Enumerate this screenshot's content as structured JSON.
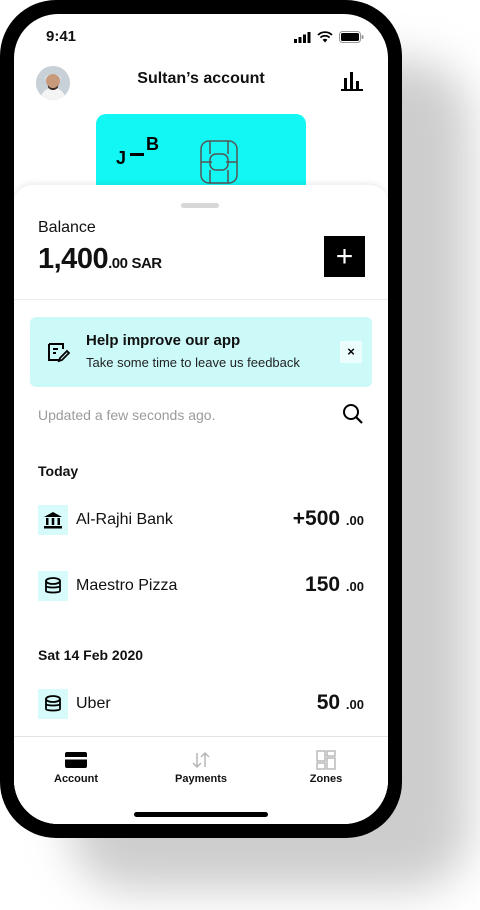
{
  "status_bar": {
    "time": "9:41"
  },
  "header": {
    "title": "Sultan’s account"
  },
  "card": {
    "logo": "J—B",
    "color": "#12f7f3"
  },
  "balance": {
    "label": "Balance",
    "amount": "1,400",
    "decimals": ".00",
    "currency": "SAR"
  },
  "feedback": {
    "title": "Help improve our app",
    "text": "Take some time to leave us feedback",
    "close": "×"
  },
  "updated_text": "Updated a few seconds ago.",
  "sections": [
    {
      "label": "Today",
      "transactions": [
        {
          "name": "Al-Rajhi Bank",
          "amount": "+500",
          "decimals": ".00",
          "icon": "bank-icon"
        },
        {
          "name": "Maestro Pizza",
          "amount": "150",
          "decimals": ".00",
          "icon": "coins-icon"
        }
      ]
    },
    {
      "label": "Sat 14 Feb 2020",
      "transactions": [
        {
          "name": "Uber",
          "amount": "50",
          "decimals": ".00",
          "icon": "coins-icon"
        }
      ]
    }
  ],
  "tabs": [
    {
      "label": "Account",
      "icon": "account-card-icon",
      "active": true
    },
    {
      "label": "Payments",
      "icon": "transfer-arrows-icon",
      "active": false
    },
    {
      "label": "Zones",
      "icon": "grid-icon",
      "active": false
    }
  ],
  "colors": {
    "accent": "#12f7f3",
    "feedback_bg": "#ccfaf9",
    "icon_bg": "#d6fbfa"
  }
}
